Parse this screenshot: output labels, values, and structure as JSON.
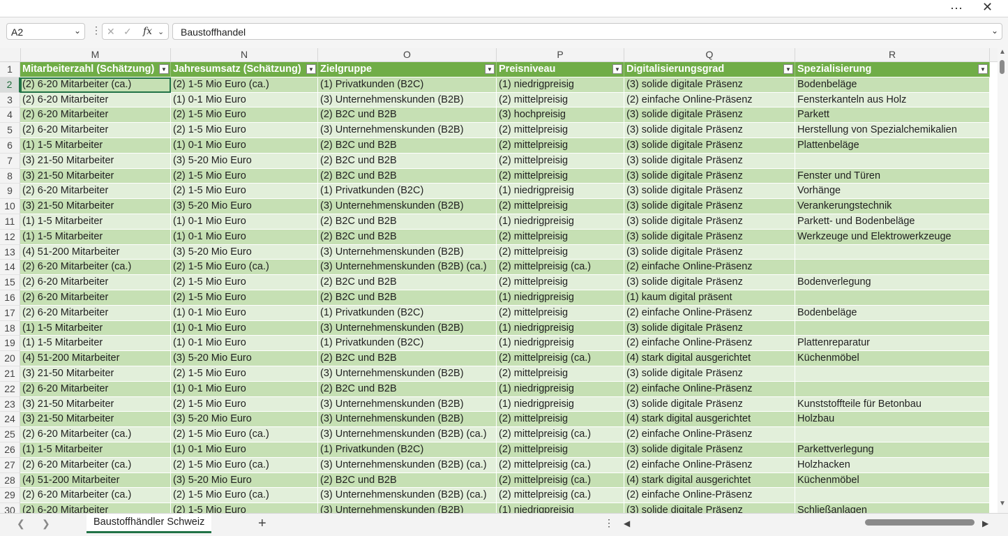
{
  "window": {
    "more_icon": "⋯",
    "close_icon": "✕"
  },
  "formula_bar": {
    "name_box": "A2",
    "formula": "Baustoffhandel",
    "fx_label": "fx"
  },
  "columns": [
    {
      "letter": "M",
      "header": "Mitarbeiterzahl (Schätzung)"
    },
    {
      "letter": "N",
      "header": "Jahresumsatz (Schätzung)"
    },
    {
      "letter": "O",
      "header": "Zielgruppe"
    },
    {
      "letter": "P",
      "header": "Preisniveau"
    },
    {
      "letter": "Q",
      "header": "Digitalisierungsgrad"
    },
    {
      "letter": "R",
      "header": "Spezialisierung"
    }
  ],
  "rows": [
    {
      "num": "1"
    },
    {
      "num": "2",
      "cells": [
        "(2) 6-20 Mitarbeiter (ca.)",
        "(2) 1-5 Mio Euro (ca.)",
        "(1) Privatkunden (B2C)",
        "(1) niedrigpreisig",
        "(3) solide digitale Präsenz",
        "Bodenbeläge"
      ]
    },
    {
      "num": "3",
      "cells": [
        "(2) 6-20 Mitarbeiter",
        "(1) 0-1 Mio Euro",
        "(3) Unternehmenskunden (B2B)",
        "(2) mittelpreisig",
        "(2) einfache Online-Präsenz",
        "Fensterkanteln aus Holz"
      ]
    },
    {
      "num": "4",
      "cells": [
        "(2) 6-20 Mitarbeiter",
        "(2) 1-5 Mio Euro",
        "(2) B2C und B2B",
        "(3) hochpreisig",
        "(3) solide digitale Präsenz",
        "Parkett"
      ]
    },
    {
      "num": "5",
      "cells": [
        "(2) 6-20 Mitarbeiter",
        "(2) 1-5 Mio Euro",
        "(3) Unternehmenskunden (B2B)",
        "(2) mittelpreisig",
        "(3) solide digitale Präsenz",
        "Herstellung von Spezialchemikalien"
      ]
    },
    {
      "num": "6",
      "cells": [
        "(1) 1-5 Mitarbeiter",
        "(1) 0-1 Mio Euro",
        "(2) B2C und B2B",
        "(2) mittelpreisig",
        "(3) solide digitale Präsenz",
        "Plattenbeläge"
      ]
    },
    {
      "num": "7",
      "cells": [
        "(3) 21-50 Mitarbeiter",
        "(3) 5-20 Mio Euro",
        "(2) B2C und B2B",
        "(2) mittelpreisig",
        "(3) solide digitale Präsenz",
        ""
      ]
    },
    {
      "num": "8",
      "cells": [
        "(3) 21-50 Mitarbeiter",
        "(2) 1-5 Mio Euro",
        "(2) B2C und B2B",
        "(2) mittelpreisig",
        "(3) solide digitale Präsenz",
        "Fenster und Türen"
      ]
    },
    {
      "num": "9",
      "cells": [
        "(2) 6-20 Mitarbeiter",
        "(2) 1-5 Mio Euro",
        "(1) Privatkunden (B2C)",
        "(1) niedrigpreisig",
        "(3) solide digitale Präsenz",
        "Vorhänge"
      ]
    },
    {
      "num": "10",
      "cells": [
        "(3) 21-50 Mitarbeiter",
        "(3) 5-20 Mio Euro",
        "(3) Unternehmenskunden (B2B)",
        "(2) mittelpreisig",
        "(3) solide digitale Präsenz",
        "Verankerungstechnik"
      ]
    },
    {
      "num": "11",
      "cells": [
        "(1) 1-5 Mitarbeiter",
        "(1) 0-1 Mio Euro",
        "(2) B2C und B2B",
        "(1) niedrigpreisig",
        "(3) solide digitale Präsenz",
        "Parkett- und Bodenbeläge"
      ]
    },
    {
      "num": "12",
      "cells": [
        "(1) 1-5 Mitarbeiter",
        "(1) 0-1 Mio Euro",
        "(2) B2C und B2B",
        "(2) mittelpreisig",
        "(3) solide digitale Präsenz",
        "Werkzeuge und Elektrowerkzeuge"
      ]
    },
    {
      "num": "13",
      "cells": [
        "(4) 51-200 Mitarbeiter",
        "(3) 5-20 Mio Euro",
        "(3) Unternehmenskunden (B2B)",
        "(2) mittelpreisig",
        "(3) solide digitale Präsenz",
        ""
      ]
    },
    {
      "num": "14",
      "cells": [
        "(2) 6-20 Mitarbeiter (ca.)",
        "(2) 1-5 Mio Euro (ca.)",
        "(3) Unternehmenskunden (B2B) (ca.)",
        "(2) mittelpreisig (ca.)",
        "(2) einfache Online-Präsenz",
        ""
      ]
    },
    {
      "num": "15",
      "cells": [
        "(2) 6-20 Mitarbeiter",
        "(2) 1-5 Mio Euro",
        "(2) B2C und B2B",
        "(2) mittelpreisig",
        "(3) solide digitale Präsenz",
        "Bodenverlegung"
      ]
    },
    {
      "num": "16",
      "cells": [
        "(2) 6-20 Mitarbeiter",
        "(2) 1-5 Mio Euro",
        "(2) B2C und B2B",
        "(1) niedrigpreisig",
        "(1) kaum digital präsent",
        ""
      ]
    },
    {
      "num": "17",
      "cells": [
        "(2) 6-20 Mitarbeiter",
        "(1) 0-1 Mio Euro",
        "(1) Privatkunden (B2C)",
        "(2) mittelpreisig",
        "(2) einfache Online-Präsenz",
        "Bodenbeläge"
      ]
    },
    {
      "num": "18",
      "cells": [
        "(1) 1-5 Mitarbeiter",
        "(1) 0-1 Mio Euro",
        "(3) Unternehmenskunden (B2B)",
        "(1) niedrigpreisig",
        "(3) solide digitale Präsenz",
        ""
      ]
    },
    {
      "num": "19",
      "cells": [
        "(1) 1-5 Mitarbeiter",
        "(1) 0-1 Mio Euro",
        "(1) Privatkunden (B2C)",
        "(1) niedrigpreisig",
        "(2) einfache Online-Präsenz",
        "Plattenreparatur"
      ]
    },
    {
      "num": "20",
      "cells": [
        "(4) 51-200 Mitarbeiter",
        "(3) 5-20 Mio Euro",
        "(2) B2C und B2B",
        "(2) mittelpreisig (ca.)",
        "(4) stark digital ausgerichtet",
        "Küchenmöbel"
      ]
    },
    {
      "num": "21",
      "cells": [
        "(3) 21-50 Mitarbeiter",
        "(2) 1-5 Mio Euro",
        "(3) Unternehmenskunden (B2B)",
        "(2) mittelpreisig",
        "(3) solide digitale Präsenz",
        ""
      ]
    },
    {
      "num": "22",
      "cells": [
        "(2) 6-20 Mitarbeiter",
        "(1) 0-1 Mio Euro",
        "(2) B2C und B2B",
        "(1) niedrigpreisig",
        "(2) einfache Online-Präsenz",
        ""
      ]
    },
    {
      "num": "23",
      "cells": [
        "(3) 21-50 Mitarbeiter",
        "(2) 1-5 Mio Euro",
        "(3) Unternehmenskunden (B2B)",
        "(1) niedrigpreisig",
        "(3) solide digitale Präsenz",
        "Kunststoffteile für Betonbau"
      ]
    },
    {
      "num": "24",
      "cells": [
        "(3) 21-50 Mitarbeiter",
        "(3) 5-20 Mio Euro",
        "(3) Unternehmenskunden (B2B)",
        "(2) mittelpreisig",
        "(4) stark digital ausgerichtet",
        "Holzbau"
      ]
    },
    {
      "num": "25",
      "cells": [
        "(2) 6-20 Mitarbeiter (ca.)",
        "(2) 1-5 Mio Euro (ca.)",
        "(3) Unternehmenskunden (B2B) (ca.)",
        "(2) mittelpreisig (ca.)",
        "(2) einfache Online-Präsenz",
        ""
      ]
    },
    {
      "num": "26",
      "cells": [
        "(1) 1-5 Mitarbeiter",
        "(1) 0-1 Mio Euro",
        "(1) Privatkunden (B2C)",
        "(2) mittelpreisig",
        "(3) solide digitale Präsenz",
        "Parkettverlegung"
      ]
    },
    {
      "num": "27",
      "cells": [
        "(2) 6-20 Mitarbeiter (ca.)",
        "(2) 1-5 Mio Euro (ca.)",
        "(3) Unternehmenskunden (B2B) (ca.)",
        "(2) mittelpreisig (ca.)",
        "(2) einfache Online-Präsenz",
        "Holzhacken"
      ]
    },
    {
      "num": "28",
      "cells": [
        "(4) 51-200 Mitarbeiter",
        "(3) 5-20 Mio Euro",
        "(2) B2C und B2B",
        "(2) mittelpreisig (ca.)",
        "(4) stark digital ausgerichtet",
        "Küchenmöbel"
      ]
    },
    {
      "num": "29",
      "cells": [
        "(2) 6-20 Mitarbeiter (ca.)",
        "(2) 1-5 Mio Euro (ca.)",
        "(3) Unternehmenskunden (B2B) (ca.)",
        "(2) mittelpreisig (ca.)",
        "(2) einfache Online-Präsenz",
        ""
      ]
    },
    {
      "num": "30",
      "cells": [
        "(2) 6-20 Mitarbeiter",
        "(2) 1-5 Mio Euro",
        "(3) Unternehmenskunden (B2B)",
        "(1) niedrigpreisig",
        "(3) solide digitale Präsenz",
        "Schließanlagen"
      ]
    }
  ],
  "sheet_tabs": {
    "active": "Baustoffhändler Schweiz",
    "add_icon": "+"
  },
  "colors": {
    "header_green": "#70ad47",
    "band_dark": "#c6e0b4",
    "band_light": "#e2efda",
    "accent": "#217346"
  }
}
